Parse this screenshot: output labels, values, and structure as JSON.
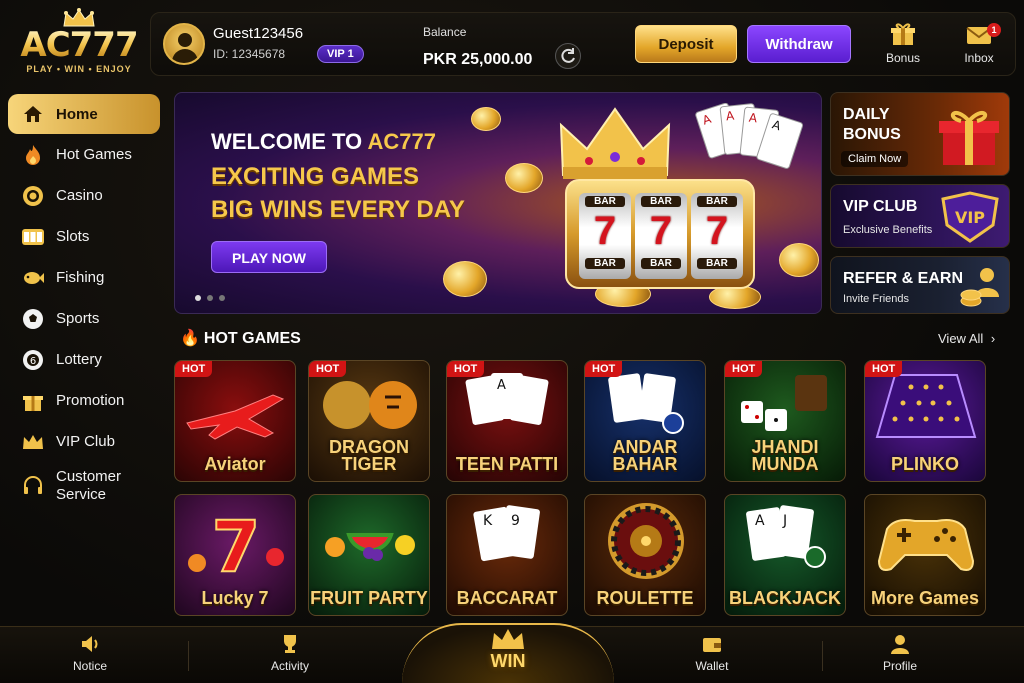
{
  "logo": {
    "name": "AC777",
    "tagline": "PLAY • WIN • ENJOY"
  },
  "user": {
    "name": "Guest123456",
    "id": "ID: 12345678",
    "vip": "VIP 1"
  },
  "balance": {
    "label": "Balance",
    "value": "PKR 25,000.00"
  },
  "header": {
    "deposit": "Deposit",
    "withdraw": "Withdraw",
    "bonus": "Bonus",
    "inbox": "Inbox",
    "inbox_count": "1"
  },
  "sidebar": {
    "items": [
      {
        "label": "Home",
        "icon": "home-icon"
      },
      {
        "label": "Hot Games",
        "icon": "fire-icon"
      },
      {
        "label": "Casino",
        "icon": "chip-icon"
      },
      {
        "label": "Slots",
        "icon": "slot-icon"
      },
      {
        "label": "Fishing",
        "icon": "fish-icon"
      },
      {
        "label": "Sports",
        "icon": "ball-icon"
      },
      {
        "label": "Lottery",
        "icon": "lottery-icon"
      },
      {
        "label": "Promotion",
        "icon": "gift-icon"
      },
      {
        "label": "VIP Club",
        "icon": "crown-icon"
      },
      {
        "label": "Customer Service",
        "icon": "headset-icon"
      }
    ]
  },
  "banner": {
    "welcome_prefix": "WELCOME TO ",
    "welcome_brand": "AC777",
    "line1": "EXCITING GAMES",
    "line2": "BIG WINS EVERY DAY",
    "cta": "PLAY NOW",
    "reel_top": "BAR",
    "reel_symbol": "7",
    "reel_bottom": "BAR"
  },
  "promos": {
    "daily": {
      "title1": "DAILY",
      "title2": "BONUS",
      "cta": "Claim Now"
    },
    "vip": {
      "title": "VIP CLUB",
      "sub": "Exclusive Benefits",
      "badge": "VIP"
    },
    "refer": {
      "title": "REFER & EARN",
      "sub": "Invite Friends"
    }
  },
  "hot_games": {
    "title": "HOT GAMES",
    "view_all": "View All",
    "hot_tag": "HOT",
    "row1": [
      {
        "name": "Aviator"
      },
      {
        "name": "DRAGON TIGER"
      },
      {
        "name": "TEEN PATTI"
      },
      {
        "name": "ANDAR BAHAR"
      },
      {
        "name": "JHANDI MUNDA"
      },
      {
        "name": "PLINKO"
      }
    ],
    "row2": [
      {
        "name": "Lucky 7"
      },
      {
        "name": "FRUIT PARTY"
      },
      {
        "name": "BACCARAT"
      },
      {
        "name": "ROULETTE"
      },
      {
        "name": "BLACKJACK"
      },
      {
        "name": "More Games"
      }
    ]
  },
  "bottom_nav": {
    "notice": "Notice",
    "activity": "Activity",
    "win": "WIN",
    "wallet": "Wallet",
    "profile": "Profile"
  },
  "colors": {
    "gold": "#f2c24a",
    "purple": "#6a2ae6",
    "hot_red": "#d11414",
    "background": "#0b0a08"
  }
}
